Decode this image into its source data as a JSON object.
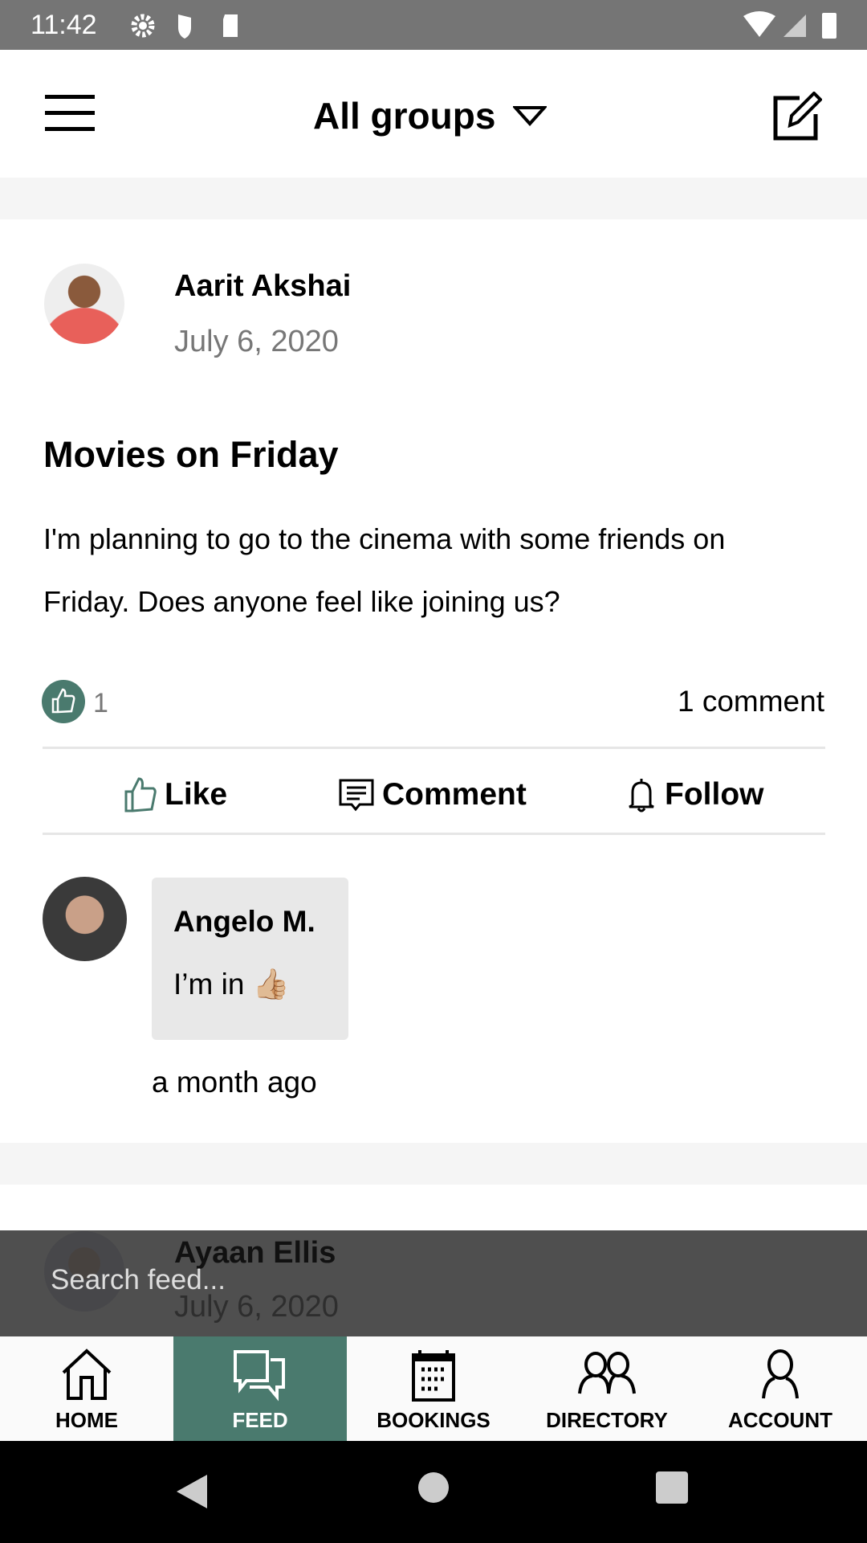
{
  "status_bar": {
    "time": "11:42",
    "icons": [
      "gear-icon",
      "shield-icon",
      "sd-card-icon",
      "wifi-icon",
      "signal-icon",
      "battery-icon"
    ]
  },
  "header": {
    "title": "All groups",
    "menu_icon": "hamburger-icon",
    "compose_icon": "edit-icon"
  },
  "post": {
    "author": "Aarit Akshai",
    "date": "July 6, 2020",
    "title": "Movies on Friday",
    "body_line1": "I'm planning to go to the cinema with some friends on",
    "body_line2": "Friday. Does anyone feel like joining us?",
    "like_count": "1",
    "comment_count": "1 comment",
    "actions": {
      "like": "Like",
      "comment": "Comment",
      "follow": "Follow"
    },
    "comment": {
      "author": "Angelo M.",
      "text": "I’m in 👍🏼",
      "time": "a month ago"
    }
  },
  "next_post": {
    "author": "Ayaan Ellis",
    "date": "July 6, 2020"
  },
  "search": {
    "placeholder": "Search feed..."
  },
  "nav": {
    "items": [
      {
        "label": "HOME"
      },
      {
        "label": "FEED",
        "active": true
      },
      {
        "label": "BOOKINGS"
      },
      {
        "label": "DIRECTORY"
      },
      {
        "label": "ACCOUNT"
      }
    ]
  },
  "colors": {
    "accent": "#4a7a6e"
  }
}
